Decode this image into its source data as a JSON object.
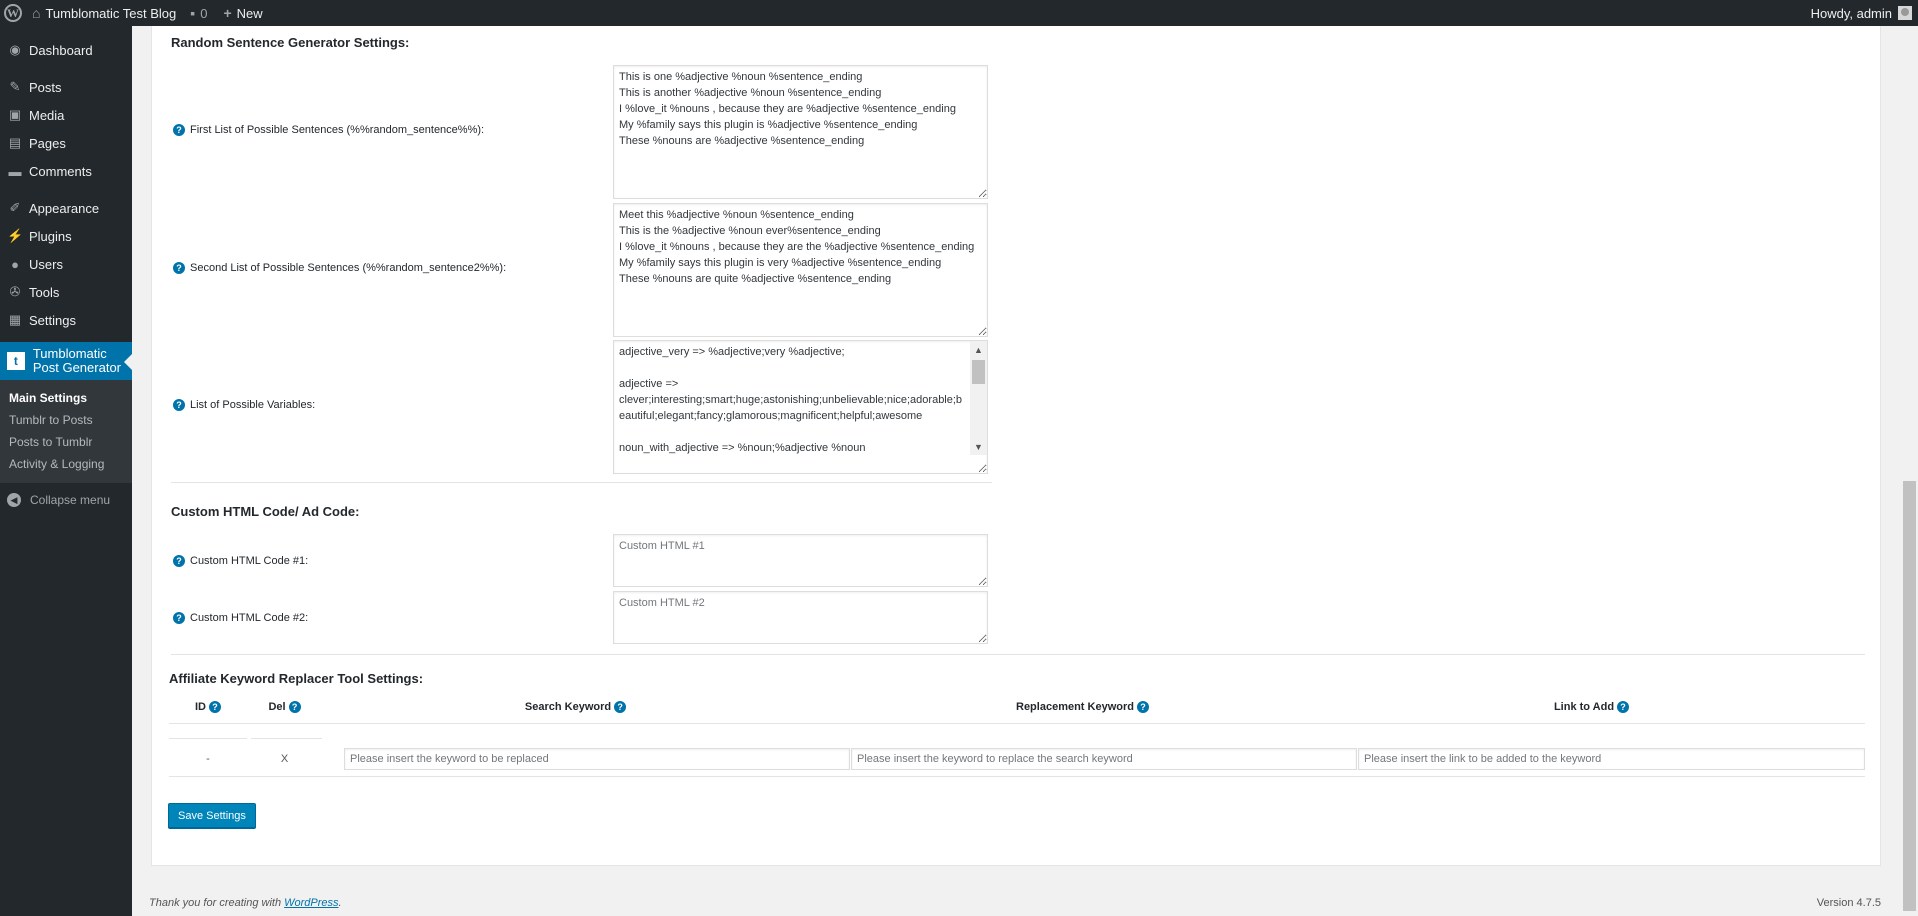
{
  "adminbar": {
    "site_name": "Tumblomatic Test Blog",
    "comments_count": "0",
    "new_label": "New",
    "howdy": "Howdy, admin",
    "wp_glyph": "W"
  },
  "sidebar": {
    "items": [
      {
        "label": "Dashboard",
        "icon": "dashboard-icon"
      },
      {
        "label": "Posts",
        "icon": "pin-icon"
      },
      {
        "label": "Media",
        "icon": "media-icon"
      },
      {
        "label": "Pages",
        "icon": "pages-icon"
      },
      {
        "label": "Comments",
        "icon": "comment-icon"
      },
      {
        "label": "Appearance",
        "icon": "brush-icon"
      },
      {
        "label": "Plugins",
        "icon": "plug-icon"
      },
      {
        "label": "Users",
        "icon": "user-icon"
      },
      {
        "label": "Tools",
        "icon": "wrench-icon"
      },
      {
        "label": "Settings",
        "icon": "settings-icon"
      }
    ],
    "current": {
      "label": "Tumblomatic Post Generator",
      "icon": "tumblr-icon"
    },
    "submenu": [
      "Main Settings",
      "Tumblr to Posts",
      "Posts to Tumblr",
      "Activity & Logging"
    ],
    "collapse": "Collapse menu"
  },
  "random_sentence": {
    "title": "Random Sentence Generator Settings:",
    "first_label": "First List of Possible Sentences (%%random_sentence%%):",
    "first_value": "This is one %adjective %noun %sentence_ending\nThis is another %adjective %noun %sentence_ending\nI %love_it %nouns , because they are %adjective %sentence_ending\nMy %family says this plugin is %adjective %sentence_ending\nThese %nouns are %adjective %sentence_ending",
    "second_label": "Second List of Possible Sentences (%%random_sentence2%%):",
    "second_value": "Meet this %adjective %noun %sentence_ending\nThis is the %adjective %noun ever%sentence_ending\nI %love_it %nouns , because they are the %adjective %sentence_ending\nMy %family says this plugin is very %adjective %sentence_ending\nThese %nouns are quite %adjective %sentence_ending",
    "vars_label": "List of Possible Variables:",
    "vars_value": "adjective_very => %adjective;very %adjective;\n\nadjective => clever;interesting;smart;huge;astonishing;unbelievable;nice;adorable;beautiful;elegant;fancy;glamorous;magnificent;helpful;awesome\n\nnoun_with_adjective => %noun;%adjective %noun"
  },
  "custom_html": {
    "title": "Custom HTML Code/ Ad Code:",
    "label1": "Custom HTML Code #1:",
    "placeholder1": "Custom HTML #1",
    "label2": "Custom HTML Code #2:",
    "placeholder2": "Custom HTML #2"
  },
  "affiliate": {
    "title": "Affiliate Keyword Replacer Tool Settings:",
    "columns": [
      "ID",
      "Del",
      "Search Keyword",
      "Replacement Keyword",
      "Link to Add"
    ],
    "row": {
      "id": "-",
      "del": "X",
      "search_placeholder": "Please insert the keyword to be replaced",
      "replace_placeholder": "Please insert the keyword to replace the search keyword",
      "link_placeholder": "Please insert the link to be added to the keyword"
    }
  },
  "save_label": "Save Settings",
  "footer": {
    "thanks": "Thank you for creating with ",
    "link": "WordPress",
    "period": ".",
    "version": "Version 4.7.5"
  },
  "help_glyph": "?",
  "colors": {
    "accent": "#0073aa",
    "sidebar": "#23282d",
    "button": "#0085ba"
  }
}
